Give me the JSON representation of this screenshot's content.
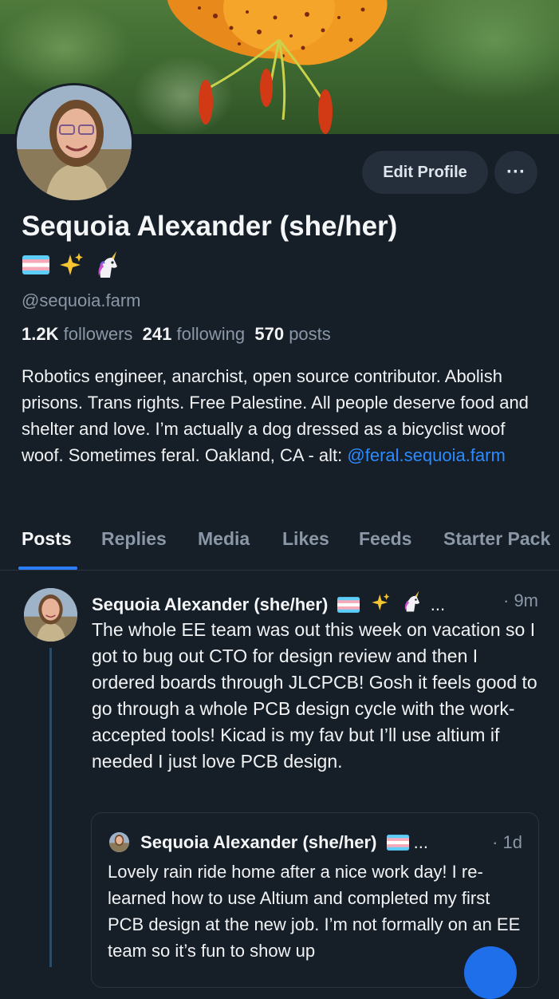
{
  "profile": {
    "display_name": "Sequoia Alexander (she/her)",
    "emojis": [
      "transgender-flag",
      "sparkles",
      "unicorn"
    ],
    "handle": "@sequoia.farm",
    "stats": {
      "followers_count": "1.2K",
      "followers_label": "followers",
      "following_count": "241",
      "following_label": "following",
      "posts_count": "570",
      "posts_label": "posts"
    },
    "bio_text": "Robotics engineer, anarchist, open source contributor. Abolish prisons. Trans rights. Free Palestine. All people deserve food and shelter and love. I’m actually a dog dressed as a bicyclist woof woof. Sometimes feral. Oakland, CA - alt: ",
    "bio_link": "@feral.sequoia.farm",
    "edit_button": "Edit Profile",
    "more_button": "···"
  },
  "tabs": [
    {
      "label": "Posts",
      "active": true
    },
    {
      "label": "Replies",
      "active": false
    },
    {
      "label": "Media",
      "active": false
    },
    {
      "label": "Likes",
      "active": false
    },
    {
      "label": "Feeds",
      "active": false
    },
    {
      "label": "Starter Pack",
      "active": false
    }
  ],
  "post": {
    "author": "Sequoia Alexander (she/her)",
    "ellipsis": "...",
    "time": "· 9m",
    "text": "The whole EE team was out this week on vacation so I got to bug out CTO for design review and then I ordered boards through JLCPCB! Gosh it feels good to go through a whole PCB design cycle with the work-accepted tools! Kicad is my fav but I’ll use altium if needed I just love PCB design."
  },
  "quote": {
    "author": "Sequoia Alexander (she/her)",
    "ellipsis": "...",
    "time": "· 1d",
    "text": "Lovely rain ride home after a nice work day! I re-learned how to use Altium and completed my first PCB design at the new job. I’m not formally on an EE team so it’s fun to show up"
  },
  "colors": {
    "background": "#161e27",
    "accent": "#2b7fff",
    "link": "#2b8bff",
    "muted": "#8a97a6"
  }
}
